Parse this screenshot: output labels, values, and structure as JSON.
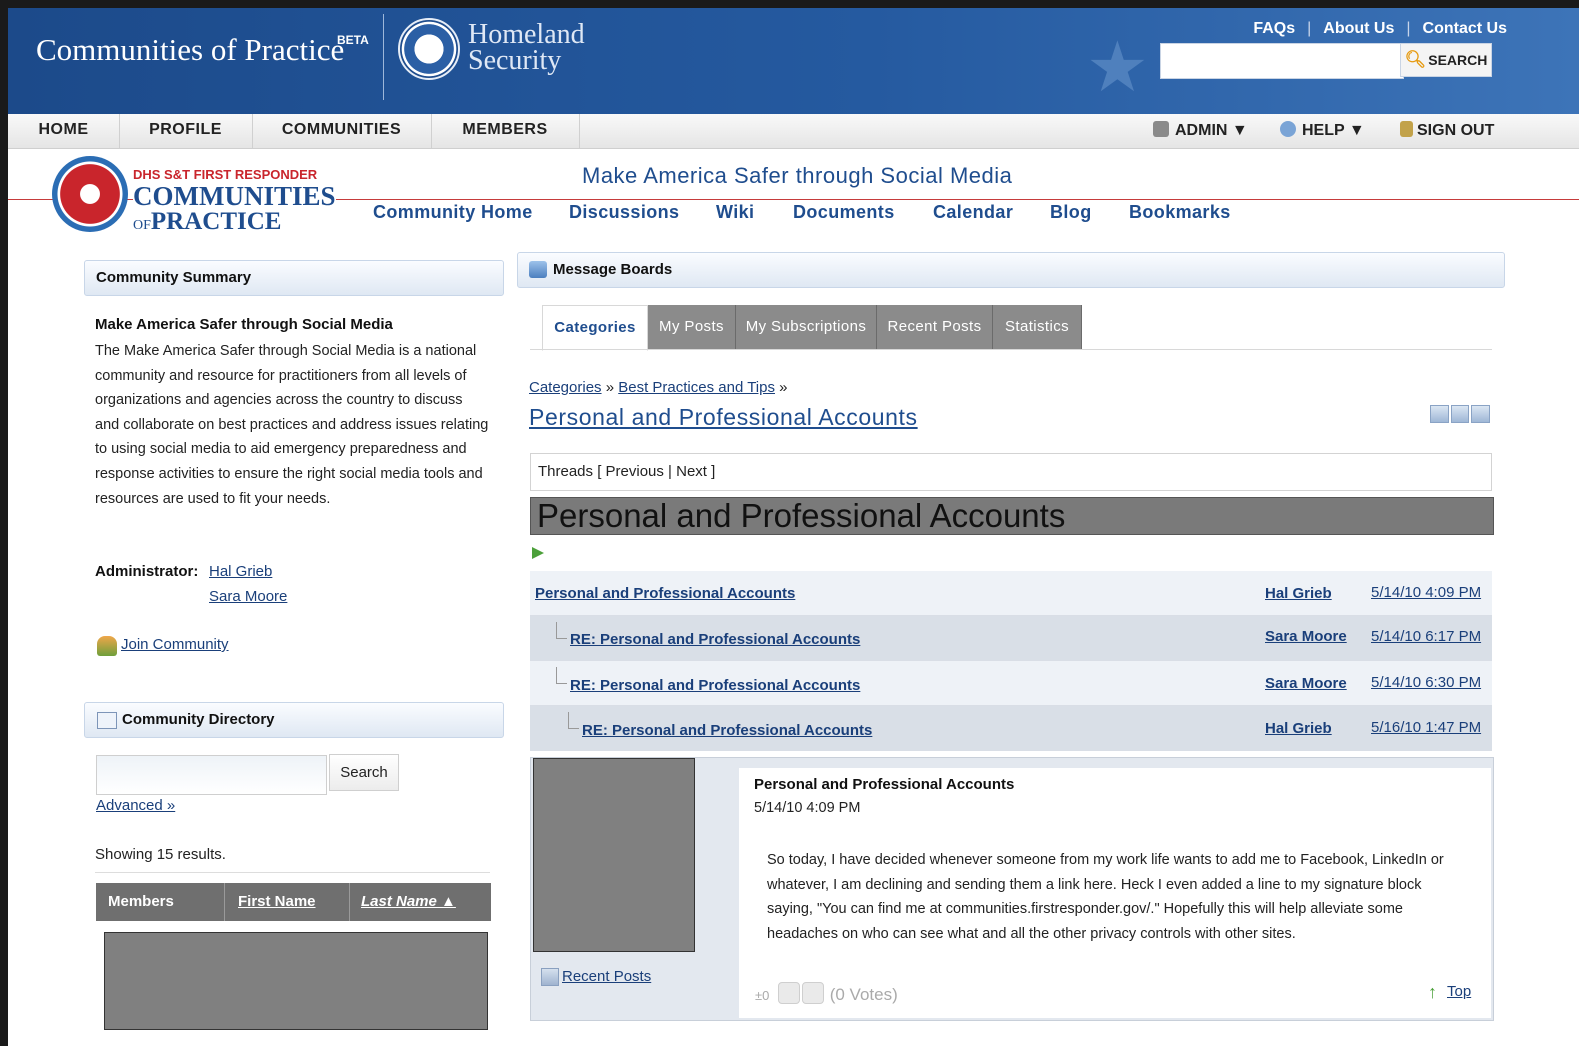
{
  "header": {
    "brand": "Communities of Practice",
    "beta": "BETA",
    "dhs_line1": "Homeland",
    "dhs_line2": "Security",
    "links": [
      "FAQs",
      "About Us",
      "Contact Us"
    ],
    "search_placeholder": "",
    "search_label": "SEARCH"
  },
  "nav": {
    "items": [
      "HOME",
      "PROFILE",
      "COMMUNITIES",
      "MEMBERS"
    ],
    "admin": "ADMIN ▼",
    "help": "HELP ▼",
    "signout": "SIGN OUT"
  },
  "community": {
    "logo_line1": "DHS S&T FIRST RESPONDER",
    "logo_line2": "COMMUNITIES",
    "logo_of": "OF",
    "logo_line3": "PRACTICE",
    "title": "Make America Safer through Social Media",
    "subnav": [
      "Community Home",
      "Discussions",
      "Wiki",
      "Documents",
      "Calendar",
      "Blog",
      "Bookmarks"
    ]
  },
  "summary": {
    "heading": "Community Summary",
    "title": "Make America Safer through Social Media",
    "body": "The Make America Safer through Social Media is a national community and resource for practitioners from all levels of organizations and agencies across the country to discuss and collaborate on best practices and address issues relating to using social media to aid emergency preparedness and response activities to ensure the right social media tools and resources are used to fit your needs.",
    "admin_label": "Administrator:",
    "admins": [
      "Hal Grieb",
      "Sara Moore"
    ],
    "join": "Join Community"
  },
  "directory": {
    "heading": "Community Directory",
    "search_value": "",
    "search_button": "Search",
    "advanced": "Advanced »",
    "showing": "Showing 15 results.",
    "columns": [
      "Members",
      "First Name",
      "Last Name ▲"
    ]
  },
  "boards": {
    "heading": "Message Boards",
    "tabs": [
      "Categories",
      "My Posts",
      "My Subscriptions",
      "Recent Posts",
      "Statistics"
    ],
    "active_tab": "Categories",
    "breadcrumb": [
      "Categories",
      "Best Practices and Tips"
    ],
    "breadcrumb_sep": "»",
    "category_title": "Personal and Professional Accounts",
    "threads_nav": "Threads [ Previous | Next ]",
    "thread_title": "Personal and Professional Accounts",
    "thread_rows": [
      {
        "subject": "Personal and Professional Accounts",
        "author": "Hal Grieb",
        "date": "5/14/10 4:09 PM"
      },
      {
        "subject": "RE: Personal and Professional Accounts",
        "author": "Sara Moore",
        "date": "5/14/10 6:17 PM"
      },
      {
        "subject": "RE: Personal and Professional Accounts",
        "author": "Sara Moore",
        "date": "5/14/10 6:30 PM"
      },
      {
        "subject": "RE: Personal and Professional Accounts",
        "author": "Hal Grieb",
        "date": "5/16/10 1:47 PM"
      }
    ],
    "post": {
      "title": "Personal and Professional Accounts",
      "date": "5/14/10 4:09 PM",
      "body": "So today, I have decided whenever someone from my work life wants to add me to Facebook, LinkedIn or whatever, I am declining and sending them a link here. Heck I even added a line to my signature block saying, \"You can find me at communities.firstresponder.gov/.\" Hopefully this will help alleviate some headaches on who can see what and all the other privacy controls with other sites.",
      "recent_posts": "Recent Posts",
      "score": "±0",
      "votes": "(0 Votes)",
      "top": "Top"
    }
  }
}
